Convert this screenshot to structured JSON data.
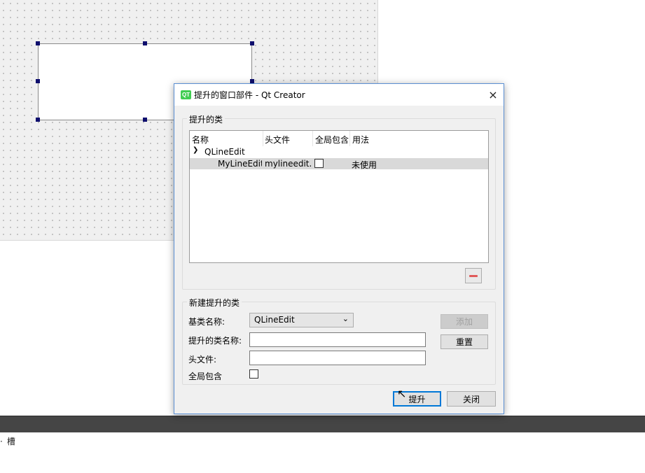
{
  "dialog": {
    "icon_text": "QT",
    "title": "提升的窗口部件 - Qt Creator",
    "close_label": "×"
  },
  "promoted_group": {
    "title": "提升的类",
    "headers": [
      "名称",
      "头文件",
      "全局包含",
      "用法"
    ],
    "tree": {
      "parent": "QLineEdit",
      "child": {
        "name": "MyLineEdit",
        "header_file": "mylineedit.h",
        "usage": "未使用"
      }
    }
  },
  "new_group": {
    "title": "新建提升的类",
    "base_class_label": "基类名称:",
    "base_class_value": "QLineEdit",
    "promoted_name_label": "提升的类名称:",
    "header_label": "头文件:",
    "global_include_label": "全局包含",
    "add_label": "添加",
    "reset_label": "重置"
  },
  "footer": {
    "promote_label": "提升",
    "close_label": "关闭"
  },
  "bottom": {
    "text": "槽"
  },
  "colors": {
    "accent": "#0078d7",
    "qt_green": "#41cd52",
    "remove_red": "#e05a5a"
  }
}
